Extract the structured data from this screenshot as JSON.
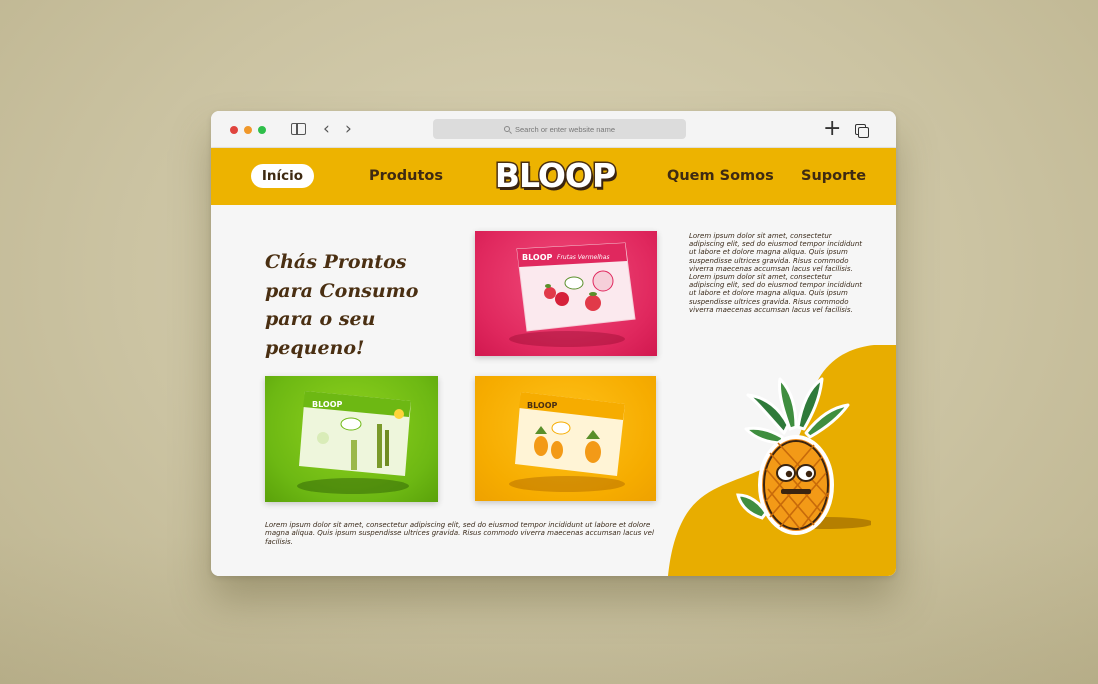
{
  "browser": {
    "url_placeholder": "Search or enter website name",
    "icons": [
      "close-dot",
      "minimize-dot",
      "maximize-dot",
      "sidebar-icon",
      "back-arrow-icon",
      "forward-arrow-icon",
      "search-icon",
      "new-tab-plus-icon",
      "tabs-overview-icon"
    ]
  },
  "nav": {
    "items": [
      {
        "label": "Início",
        "active": true
      },
      {
        "label": "Produtos",
        "active": false
      },
      {
        "label": "Quem Somos",
        "active": false
      },
      {
        "label": "Suporte",
        "active": false
      }
    ],
    "logo": "BLOOP"
  },
  "hero": {
    "headline_lines": [
      "Chás Prontos",
      "para Consumo",
      "para o seu",
      "pequeno!"
    ]
  },
  "products": [
    {
      "name": "BLOOP",
      "flavor": "Frutas Vermelhas",
      "color": "#e0285e"
    },
    {
      "name": "BLOOP",
      "flavor": "",
      "color": "#6db813"
    },
    {
      "name": "BLOOP",
      "flavor": "",
      "color": "#f6ac00"
    }
  ],
  "side_text": "Lorem ipsum dolor sit amet, consectetur adipiscing elit, sed do eiusmod tempor incididunt ut labore et dolore magna aliqua. Quis ipsum suspendisse ultrices gravida. Risus commodo viverra maecenas accumsan lacus vel facilisis. Lorem ipsum dolor sit amet, consectetur adipiscing elit, sed do eiusmod tempor incididunt ut labore et dolore magna aliqua. Quis ipsum suspendisse ultrices gravida. Risus commodo viverra maecenas accumsan lacus vel facilisis.",
  "bottom_text": "Lorem ipsum dolor sit amet, consectetur adipiscing elit, sed do eiusmod tempor incididunt ut labore et dolore magna aliqua. Quis ipsum suspendisse ultrices gravida. Risus commodo viverra maecenas accumsan lacus vel facilisis.",
  "colors": {
    "nav_bg": "#edb300",
    "brand_brown": "#4a2f12",
    "blob": "#e8ad00",
    "page_bg": "#f6f6f6"
  }
}
